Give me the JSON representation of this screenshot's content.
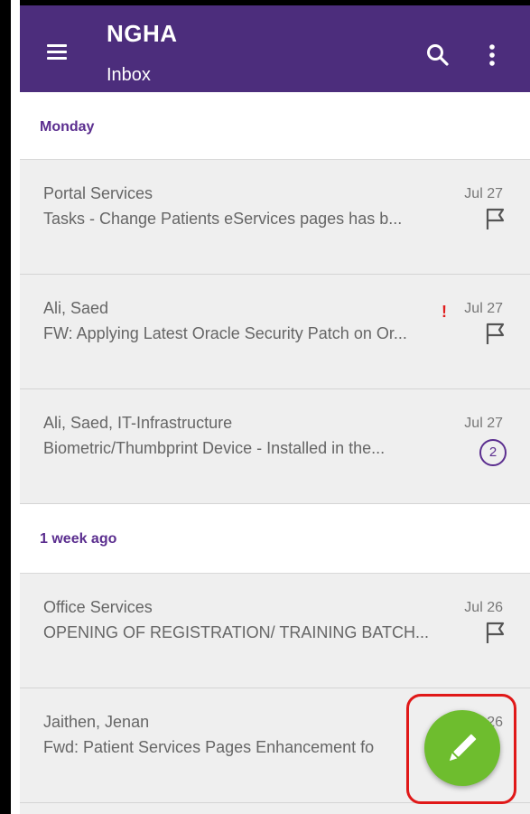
{
  "app_bar": {
    "title": "NGHA",
    "subtitle": "Inbox",
    "background": "#4c2d7c"
  },
  "sections": [
    {
      "label": "Monday"
    },
    {
      "label": "1 week ago"
    }
  ],
  "emails": [
    {
      "sender": "Portal Services",
      "date": "Jul 27",
      "subject": "Tasks - Change Patients eServices pages  has b...",
      "trailing_icon": "flag-icon"
    },
    {
      "sender": "Ali, Saed",
      "date": "Jul 27",
      "importance": "!",
      "subject": "FW: Applying Latest Oracle Security Patch on Or...",
      "trailing_icon": "flag-icon"
    },
    {
      "sender": "Ali, Saed, IT-Infrastructure",
      "date": "Jul 27",
      "subject": "Biometric/Thumbprint Device - Installed in the...",
      "thread_count": "2"
    },
    {
      "sender": "Office Services",
      "date": "Jul 26",
      "subject": "OPENING OF REGISTRATION/ TRAINING BATCH...",
      "trailing_icon": "flag-icon"
    },
    {
      "sender": "Jaithen, Jenan",
      "date": "Jul 26",
      "subject": "Fwd: Patient Services Pages Enhancement fo",
      "trailing_icon": "none"
    }
  ],
  "fab": {
    "icon": "pencil-icon",
    "color": "#6ebd2e",
    "highlight_color": "#e01818"
  },
  "colors": {
    "accent": "#5b2e8f",
    "importance": "#e01e1e"
  }
}
